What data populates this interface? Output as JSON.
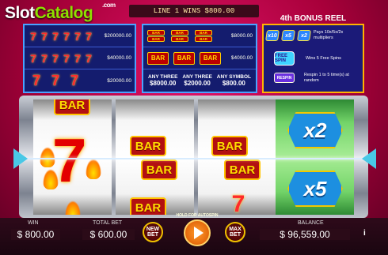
{
  "logo": {
    "part1": "Slot",
    "part2": "Catalog",
    "suffix": ".com"
  },
  "header": {
    "win_message": "LINE 1 WINS $800.00"
  },
  "symbols": {
    "bar": "BAR"
  },
  "paytable1": [
    "$200000.00",
    "$40000.00",
    "$20000.00"
  ],
  "paytable2": {
    "0": "$8000.00",
    "1": "$4000.00",
    "any1_label": "ANY THREE",
    "any1_value": "$8000.00",
    "any2_label": "ANY THREE",
    "any2_value": "$2000.00",
    "any3_label": "ANY SYMBOL",
    "any3_value": "$800.00"
  },
  "bonus": {
    "title": "4th BONUS REEL",
    "multipliers_text": "Pays 10x/5x/2x multipliers",
    "free_spins_icon": "FREE SPIN",
    "free_spins_text": "Wins 5 Free Spins",
    "respin_icon": "RESPIN",
    "respin_text": "Respin 1 to 5 time(s) at random"
  },
  "bonus_reel": {
    "top": "x2",
    "bottom": "x5"
  },
  "controls": {
    "win_label": "WIN",
    "win_value": "$ 800.00",
    "bet_label": "TOTAL BET",
    "bet_value": "$ 600.00",
    "new_bet": "NEW BET",
    "autospin_hint": "HOLD FOR AUTOSPIN",
    "max_bet": "MAX BET",
    "balance_label": "BALANCE",
    "balance_value": "$ 96,559.00"
  },
  "colors": {
    "accent": "#e2136a",
    "reel_border": "#4aa3ff",
    "bonus_border": "#ffb400"
  }
}
